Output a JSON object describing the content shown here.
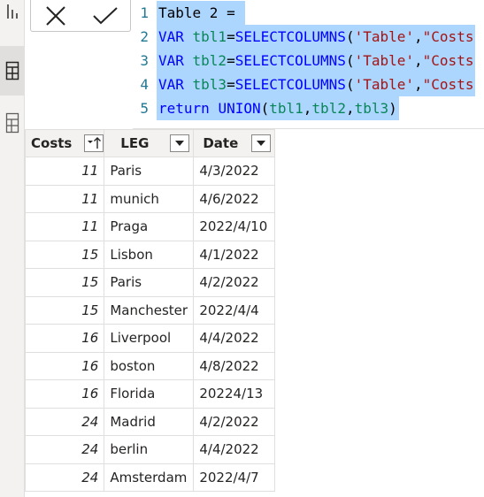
{
  "editor": {
    "lines": [
      {
        "num": "1",
        "parts": [
          {
            "cls": "txt",
            "text": "Table 2 = "
          }
        ]
      },
      {
        "num": "2",
        "parts": [
          {
            "cls": "kw",
            "text": "VAR "
          },
          {
            "cls": "var",
            "text": "tbl1"
          },
          {
            "cls": "txt",
            "text": "="
          },
          {
            "cls": "fn",
            "text": "SELECTCOLUMNS"
          },
          {
            "cls": "txt",
            "text": "("
          },
          {
            "cls": "str",
            "text": "'Table'"
          },
          {
            "cls": "txt",
            "text": ","
          },
          {
            "cls": "str",
            "text": "\"Costs"
          }
        ]
      },
      {
        "num": "3",
        "parts": [
          {
            "cls": "kw",
            "text": "VAR "
          },
          {
            "cls": "var",
            "text": "tbl2"
          },
          {
            "cls": "txt",
            "text": "="
          },
          {
            "cls": "fn",
            "text": "SELECTCOLUMNS"
          },
          {
            "cls": "txt",
            "text": "("
          },
          {
            "cls": "str",
            "text": "'Table'"
          },
          {
            "cls": "txt",
            "text": ","
          },
          {
            "cls": "str",
            "text": "\"Costs"
          }
        ]
      },
      {
        "num": "4",
        "parts": [
          {
            "cls": "kw",
            "text": "VAR "
          },
          {
            "cls": "var",
            "text": "tbl3"
          },
          {
            "cls": "txt",
            "text": "="
          },
          {
            "cls": "fn",
            "text": "SELECTCOLUMNS"
          },
          {
            "cls": "txt",
            "text": "("
          },
          {
            "cls": "str",
            "text": "'Table'"
          },
          {
            "cls": "txt",
            "text": ","
          },
          {
            "cls": "str",
            "text": "\"Costs"
          }
        ]
      },
      {
        "num": "5",
        "parts": [
          {
            "cls": "kw",
            "text": "return "
          },
          {
            "cls": "fn",
            "text": "UNION"
          },
          {
            "cls": "txt",
            "text": "("
          },
          {
            "cls": "var",
            "text": "tbl1"
          },
          {
            "cls": "txt",
            "text": ","
          },
          {
            "cls": "var",
            "text": "tbl2"
          },
          {
            "cls": "txt",
            "text": ","
          },
          {
            "cls": "var",
            "text": "tbl3"
          },
          {
            "cls": "txt",
            "text": ")"
          }
        ]
      }
    ]
  },
  "table": {
    "columns": [
      "Costs",
      "LEG",
      "Date"
    ],
    "rows": [
      [
        "11",
        "Paris",
        "4/3/2022"
      ],
      [
        "11",
        "munich",
        "4/6/2022"
      ],
      [
        "11",
        "Praga",
        "2022/4/10"
      ],
      [
        "15",
        "Lisbon",
        "4/1/2022"
      ],
      [
        "15",
        "Paris",
        "4/2/2022"
      ],
      [
        "15",
        "Manchester",
        "2022/4/4"
      ],
      [
        "16",
        "Liverpool",
        "4/4/2022"
      ],
      [
        "16",
        "boston",
        "4/8/2022"
      ],
      [
        "16",
        "Florida",
        "20224/13"
      ],
      [
        "24",
        "Madrid",
        "4/2/2022"
      ],
      [
        "24",
        "berlin",
        "4/4/2022"
      ],
      [
        "24",
        "Amsterdam",
        "2022/4/7"
      ]
    ]
  },
  "icons": {
    "rail": [
      "report-view-icon",
      "data-view-icon",
      "model-view-icon"
    ],
    "commit": [
      "cancel-icon",
      "commit-check-icon"
    ]
  },
  "colors": {
    "selection": "#add6ff",
    "keyword": "#0000ff",
    "variable": "#098658",
    "string": "#a31515",
    "line_number": "#237893"
  }
}
